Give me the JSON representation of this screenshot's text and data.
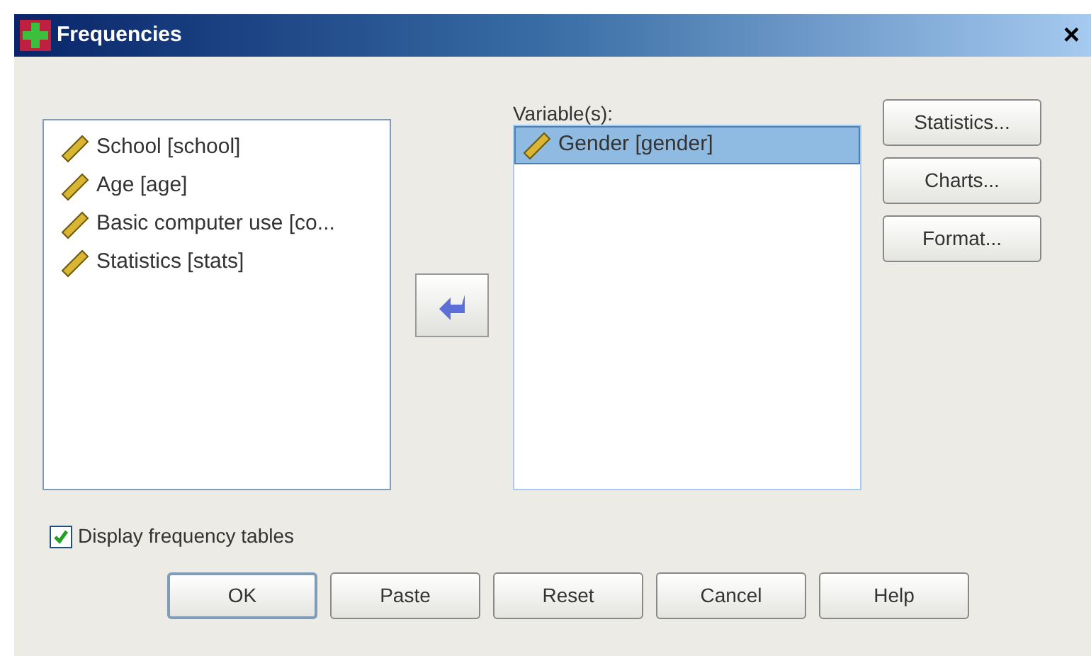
{
  "window": {
    "title": "Frequencies",
    "close": "×"
  },
  "source_list": {
    "items": [
      {
        "label": "School [school]",
        "selected": false
      },
      {
        "label": "Age [age]",
        "selected": false
      },
      {
        "label": "Basic computer use [co...",
        "selected": false
      },
      {
        "label": "Statistics [stats]",
        "selected": false
      }
    ]
  },
  "variables": {
    "label": "Variable(s):",
    "items": [
      {
        "label": "Gender [gender]",
        "selected": true
      }
    ]
  },
  "side_buttons": [
    "Statistics...",
    "Charts...",
    "Format..."
  ],
  "display_frequency_tables": {
    "label": "Display frequency tables",
    "checked": true
  },
  "buttons": [
    {
      "label": "OK",
      "default": true
    },
    {
      "label": "Paste",
      "default": false
    },
    {
      "label": "Reset",
      "default": false
    },
    {
      "label": "Cancel",
      "default": false
    },
    {
      "label": "Help",
      "default": false
    }
  ]
}
